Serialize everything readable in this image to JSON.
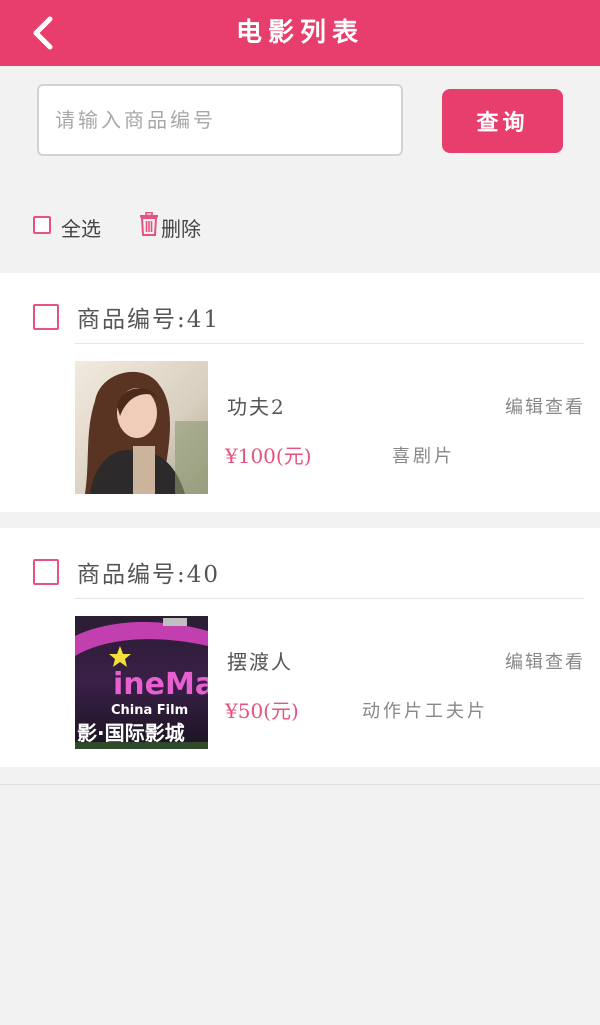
{
  "header": {
    "title": "电影列表",
    "back_icon": "chevron-left-icon",
    "background": "#e83e6e"
  },
  "search": {
    "placeholder": "请输入商品编号",
    "value": "",
    "button_label": "查询"
  },
  "toolbar": {
    "select_all_label": "全选",
    "delete_label": "删除",
    "delete_icon": "trash-icon"
  },
  "items": [
    {
      "checked": false,
      "code_label": "商品编号:41",
      "name": "功夫2",
      "price": "¥100(元)",
      "genre": "喜剧片",
      "edit_label": "编辑查看",
      "thumbnail": "portrait-photo"
    },
    {
      "checked": false,
      "code_label": "商品编号:40",
      "name": "摆渡人",
      "price": "¥50(元)",
      "genre": "动作片工夫片",
      "edit_label": "编辑查看",
      "thumbnail": "cinema-sign-photo",
      "thumbnail_texts": [
        "ineMa",
        "China Film",
        "影·国际影城"
      ]
    }
  ],
  "colors": {
    "accent": "#e83e6e",
    "price": "#e8527e"
  }
}
